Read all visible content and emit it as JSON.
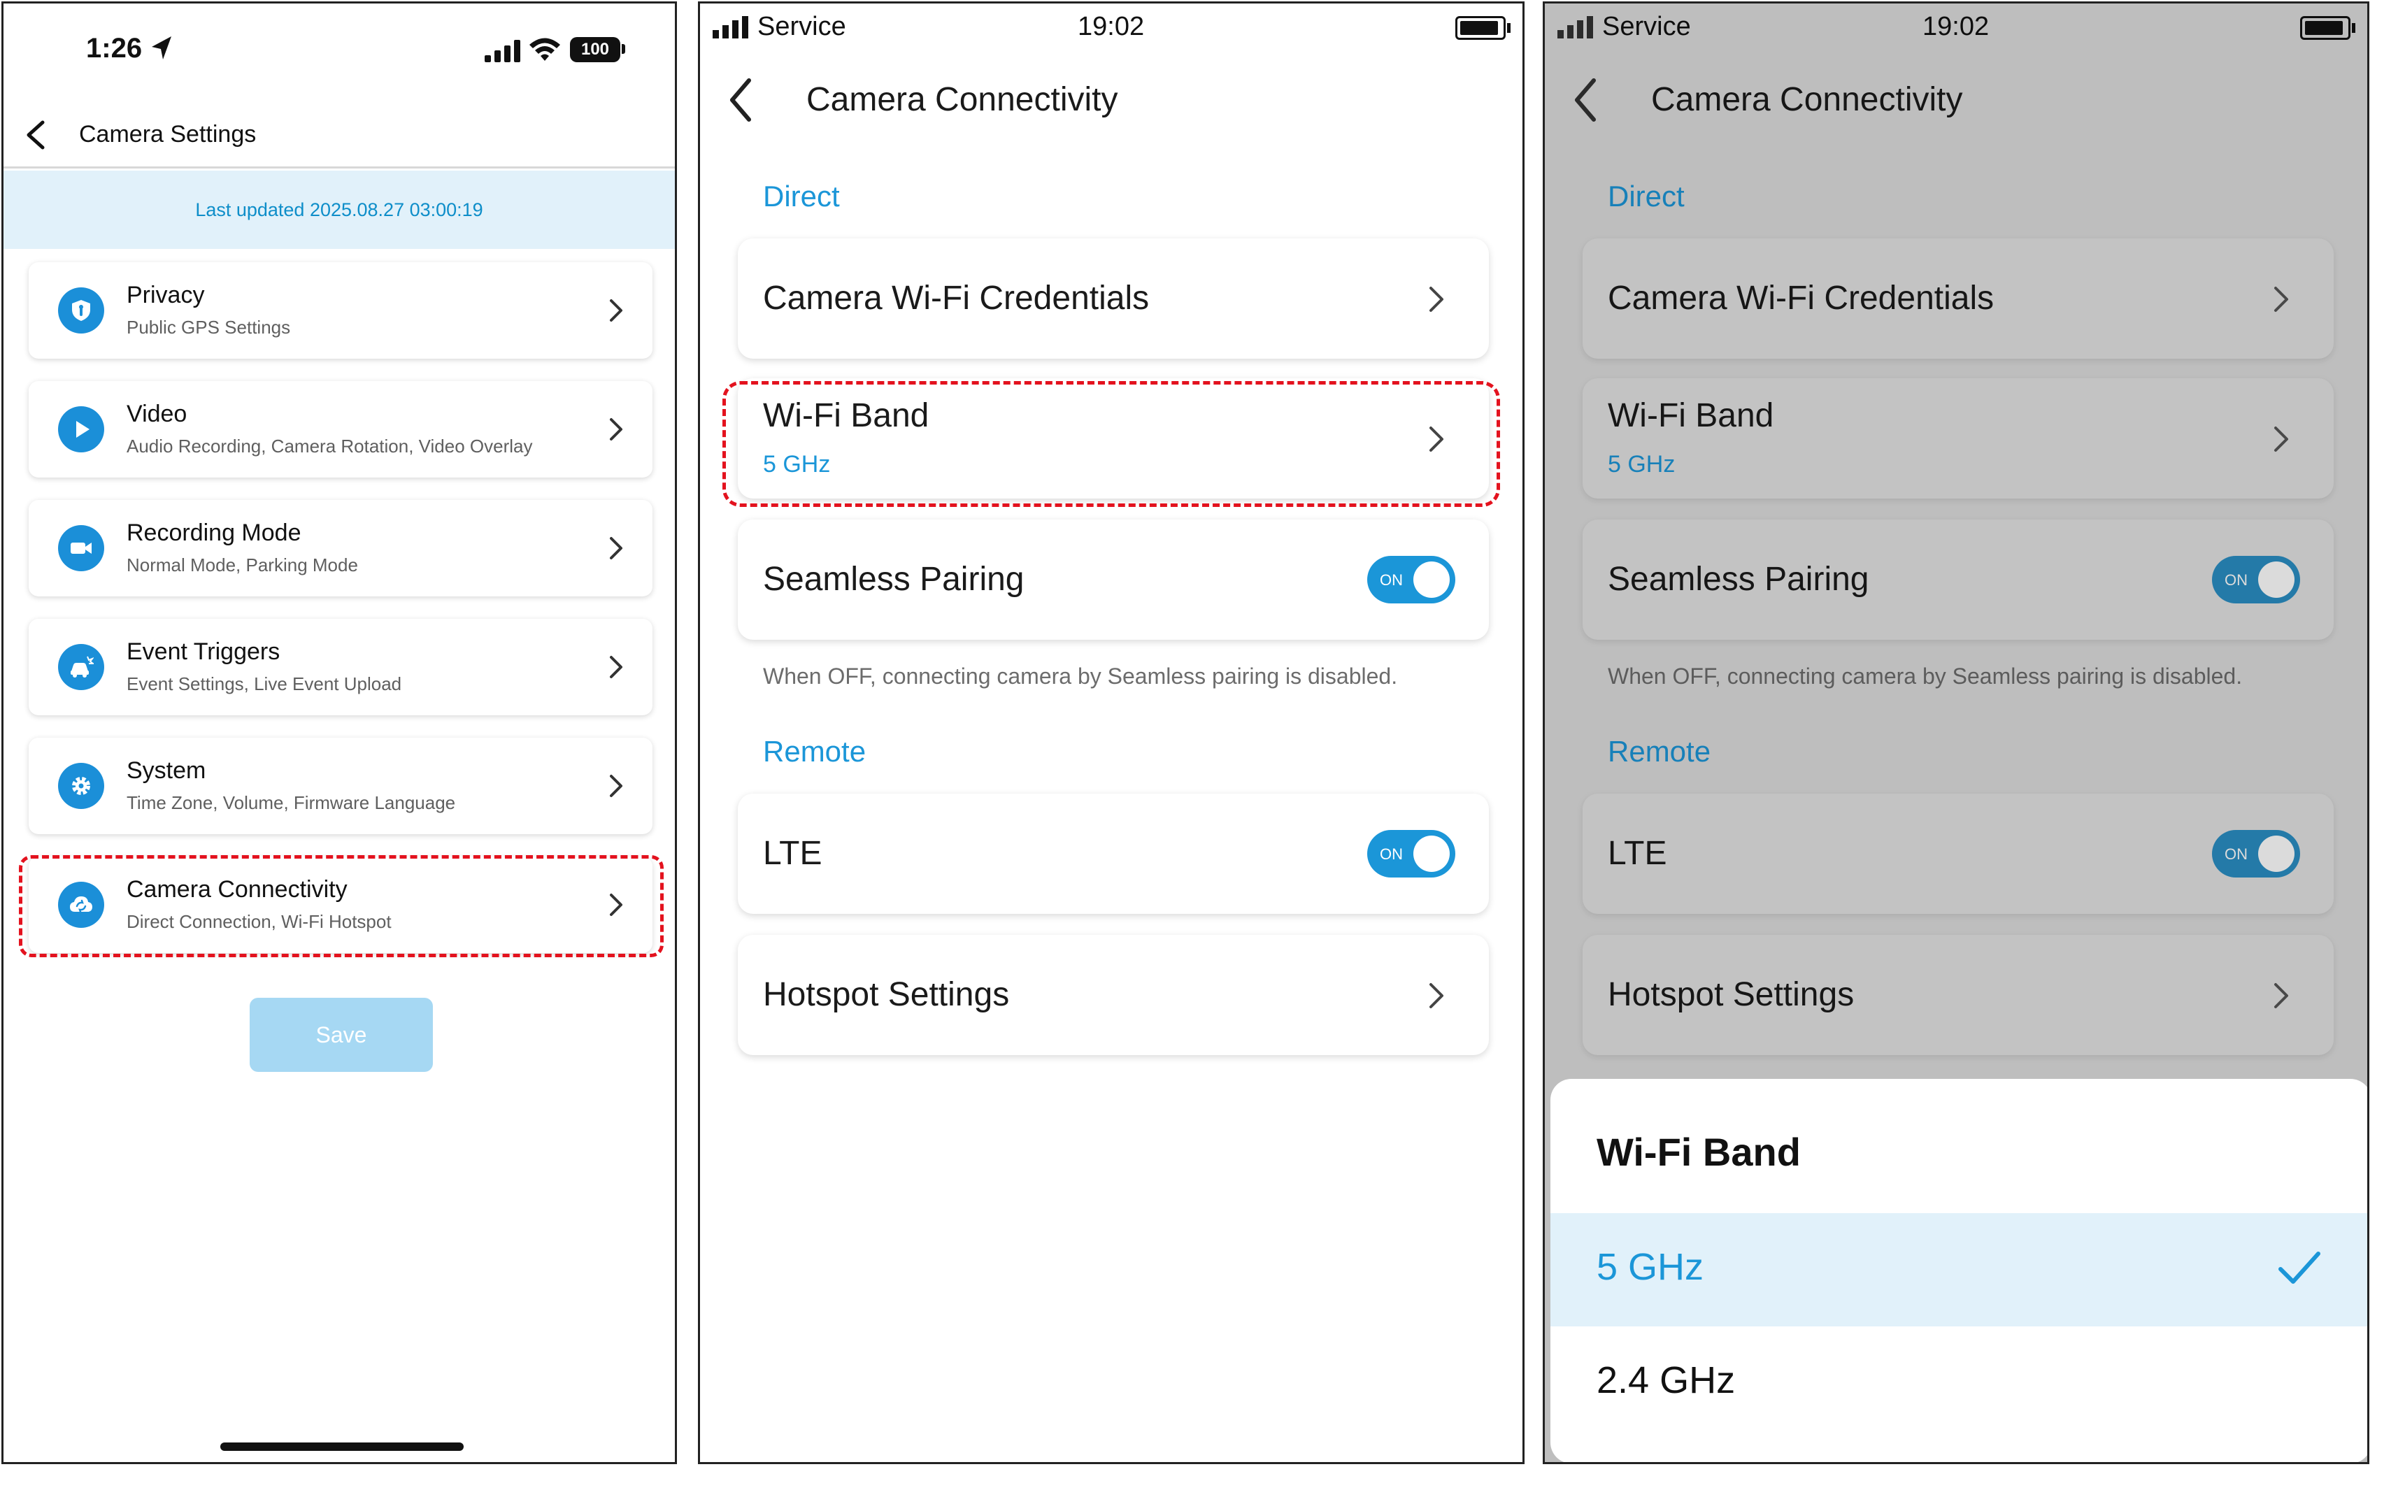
{
  "panel1": {
    "status": {
      "time": "1:26",
      "battery": "100"
    },
    "header": {
      "title": "Camera Settings"
    },
    "last_updated": "Last updated 2025.08.27 03:00:19",
    "items": [
      {
        "title": "Privacy",
        "subtitle": "Public GPS Settings",
        "icon": "shield-icon"
      },
      {
        "title": "Video",
        "subtitle": "Audio Recording, Camera Rotation, Video Overlay",
        "icon": "play-icon"
      },
      {
        "title": "Recording Mode",
        "subtitle": "Normal Mode, Parking Mode",
        "icon": "video-camera-icon"
      },
      {
        "title": "Event Triggers",
        "subtitle": "Event Settings, Live Event Upload",
        "icon": "car-impact-icon"
      },
      {
        "title": "System",
        "subtitle": "Time Zone, Volume, Firmware Language",
        "icon": "gear-icon"
      },
      {
        "title": "Camera Connectivity",
        "subtitle": "Direct Connection, Wi-Fi Hotspot",
        "icon": "cloud-sync-icon"
      }
    ],
    "save_label": "Save"
  },
  "connectivity": {
    "status": {
      "carrier": "Service",
      "time": "19:02"
    },
    "title": "Camera Connectivity",
    "direct_label": "Direct",
    "remote_label": "Remote",
    "wifi_credentials": "Camera Wi-Fi Credentials",
    "wifi_band": "Wi-Fi Band",
    "wifi_band_value": "5 GHz",
    "seamless_pairing": "Seamless Pairing",
    "seamless_hint": "When OFF, connecting camera by Seamless pairing is disabled.",
    "lte": "LTE",
    "hotspot": "Hotspot Settings",
    "toggle_on": "ON"
  },
  "sheet": {
    "title": "Wi-Fi Band",
    "options": [
      {
        "label": "5 GHz",
        "selected": true
      },
      {
        "label": "2.4 GHz",
        "selected": false
      }
    ]
  },
  "colors": {
    "accent": "#1b96d8",
    "highlight": "#e3121e",
    "info_bg": "#e1f1fa"
  }
}
